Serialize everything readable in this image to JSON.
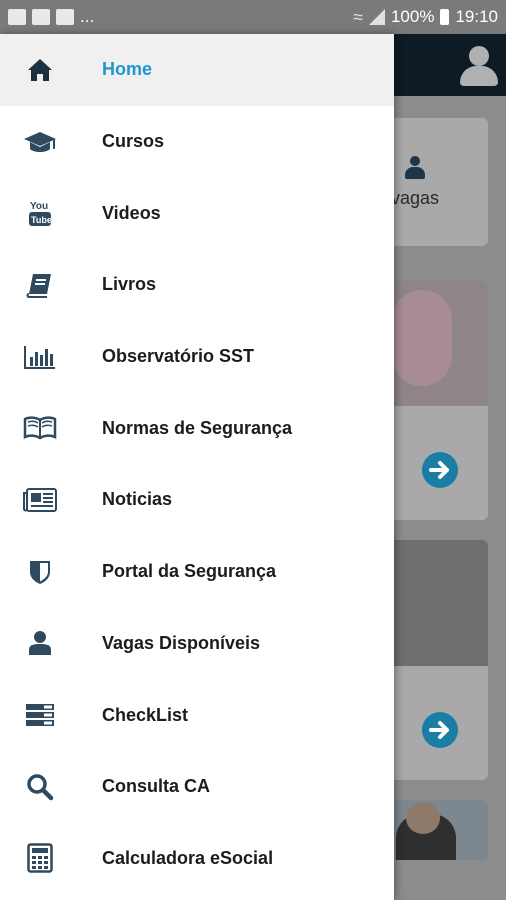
{
  "status_bar": {
    "ellipsis": "...",
    "battery": "100%",
    "time": "19:10"
  },
  "background_app": {
    "card_label": "vagas"
  },
  "menu": {
    "items": [
      {
        "label": "Home",
        "icon": "home-icon",
        "active": true
      },
      {
        "label": "Cursos",
        "icon": "graduation-cap-icon"
      },
      {
        "label": "Videos",
        "icon": "youtube-icon"
      },
      {
        "label": "Livros",
        "icon": "book-icon"
      },
      {
        "label": "Observatório SST",
        "icon": "bar-chart-icon"
      },
      {
        "label": "Normas de Segurança",
        "icon": "open-book-icon"
      },
      {
        "label": "Noticias",
        "icon": "newspaper-icon"
      },
      {
        "label": "Portal da Segurança",
        "icon": "shield-icon"
      },
      {
        "label": "Vagas Disponíveis",
        "icon": "user-icon"
      },
      {
        "label": "CheckList",
        "icon": "list-icon"
      },
      {
        "label": "Consulta CA",
        "icon": "search-icon"
      },
      {
        "label": "Calculadora eSocial",
        "icon": "calculator-icon"
      }
    ]
  },
  "colors": {
    "accent": "#2196d3",
    "icon": "#2f4a5e",
    "text": "#1c1c1c"
  }
}
